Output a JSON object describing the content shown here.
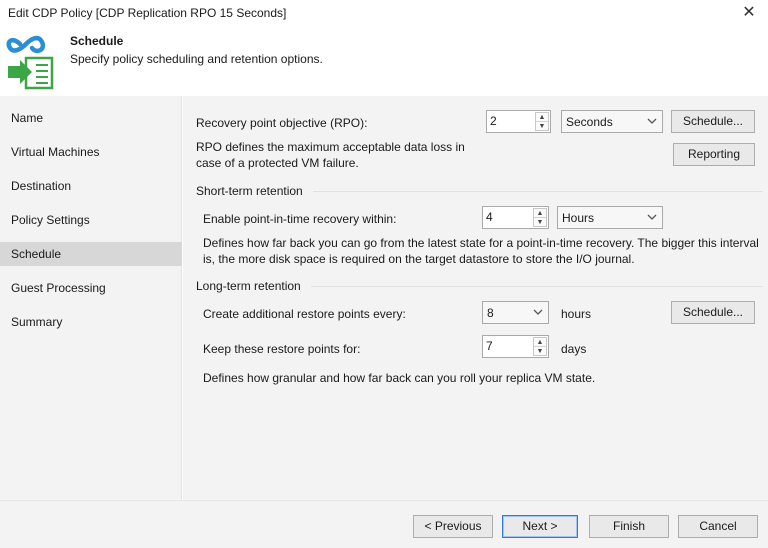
{
  "window": {
    "title": "Edit CDP Policy [CDP Replication RPO 15 Seconds]",
    "close_glyph": "✕"
  },
  "header": {
    "title": "Schedule",
    "subtitle": "Specify policy scheduling and retention options.",
    "icon": "cdp-schedule-logo-icon"
  },
  "sidebar": {
    "items": [
      {
        "label": "Name",
        "active": false
      },
      {
        "label": "Virtual Machines",
        "active": false
      },
      {
        "label": "Destination",
        "active": false
      },
      {
        "label": "Policy Settings",
        "active": false
      },
      {
        "label": "Schedule",
        "active": true
      },
      {
        "label": "Guest Processing",
        "active": false
      },
      {
        "label": "Summary",
        "active": false
      }
    ]
  },
  "rpo": {
    "label": "Recovery point objective (RPO):",
    "value": "2",
    "unit": "Seconds",
    "schedule_button": "Schedule...",
    "reporting_button": "Reporting",
    "description": "RPO defines the maximum acceptable data loss in case of a protected VM failure."
  },
  "short_term": {
    "heading": "Short-term retention",
    "label": "Enable point-in-time recovery within:",
    "value": "4",
    "unit": "Hours",
    "description": "Defines how far back you can go from the latest state for a point-in-time recovery. The bigger this interval is, the more disk space is required on the target datastore to store the I/O journal."
  },
  "long_term": {
    "heading": "Long-term retention",
    "restore_label": "Create additional restore points every:",
    "restore_value": "8",
    "restore_unit": "hours",
    "schedule_button": "Schedule...",
    "keep_label": "Keep these restore points for:",
    "keep_value": "7",
    "keep_unit": "days",
    "description": "Defines how granular and how far back can you roll your replica VM state."
  },
  "footer": {
    "previous": "< Previous",
    "next": "Next >",
    "finish": "Finish",
    "cancel": "Cancel"
  },
  "colors": {
    "panel": "#f3f3f3",
    "active_nav": "#d7d7d7",
    "logo_blue": "#2b8fd6",
    "logo_green": "#3aa645",
    "focus_border": "#2f7bd6"
  }
}
